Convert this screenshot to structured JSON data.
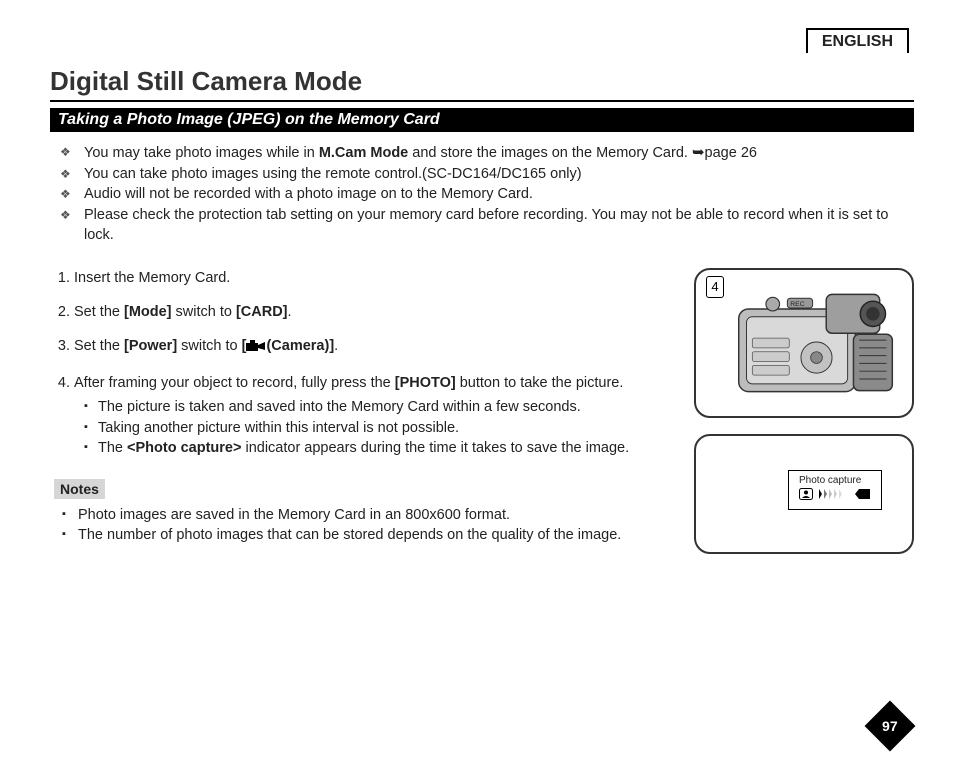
{
  "language": "ENGLISH",
  "page_title": "Digital Still Camera Mode",
  "section_title": "Taking a Photo Image (JPEG) on the Memory Card",
  "diamonds": {
    "d1_pre": "You may take photo images while in ",
    "d1_bold": "M.Cam Mode",
    "d1_post": " and store the images on the Memory Card. ",
    "d1_ref": "page 26",
    "d2": "You can take photo images using the remote control.(SC-DC164/DC165 only)",
    "d3": "Audio will not be recorded with a photo image on to the Memory Card.",
    "d4": "Please check the protection tab setting on your memory card before recording. You may not be able to record when it is set to lock."
  },
  "steps": {
    "s1": "Insert the Memory Card.",
    "s2_pre": "Set the ",
    "s2_b1": "[Mode]",
    "s2_mid": " switch to ",
    "s2_b2": "[CARD]",
    "s2_post": ".",
    "s3_pre": "Set the ",
    "s3_b1": "[Power]",
    "s3_mid": " switch to ",
    "s3_b2_open": "[",
    "s3_b2_close": "(Camera)]",
    "s3_post": ".",
    "s4_pre": "After framing your object to record, fully press the ",
    "s4_b1": "[PHOTO]",
    "s4_post": " button to take the picture.",
    "s4_sub1": "The picture is taken and saved into the Memory Card within a few seconds.",
    "s4_sub2": "Taking another picture within this interval is not possible.",
    "s4_sub3_pre": "The ",
    "s4_sub3_b": "<Photo capture>",
    "s4_sub3_post": " indicator appears during the time it takes to save the image."
  },
  "notes_label": "Notes",
  "notes": {
    "n1": "Photo images are saved in the Memory Card in an 800x600 format.",
    "n2": "The number of photo images that can be stored depends on the quality of the image."
  },
  "figure_number": "4",
  "capture_label": "Photo capture",
  "page_number": "97"
}
